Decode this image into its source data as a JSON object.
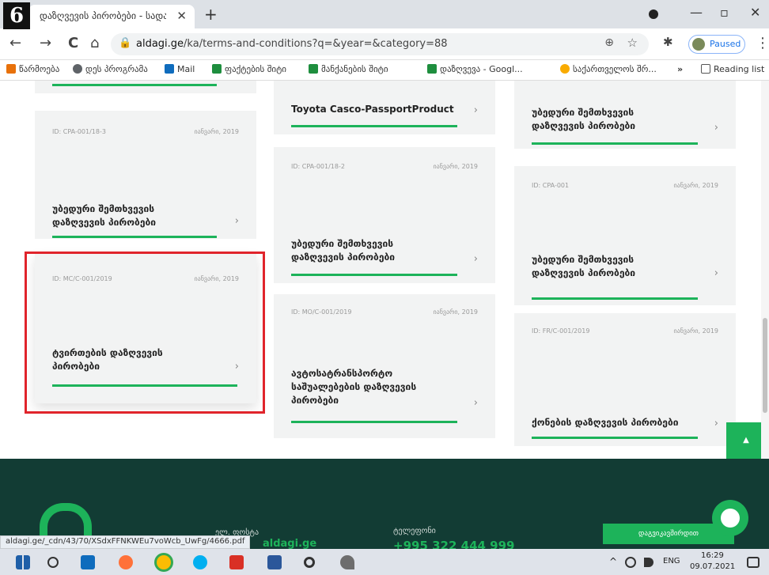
{
  "step_badge": "6",
  "tab": {
    "title": "დაზღვევის პირობები - სადაზ",
    "close": "✕",
    "new": "+"
  },
  "window": {
    "minimize": "—",
    "maximize": "▫",
    "close": "✕"
  },
  "toolbar": {
    "back": "←",
    "forward": "→",
    "reload": "C",
    "home": "⌂",
    "url_domain": "aldagi.ge",
    "url_path": "/ka/terms-and-conditions?q=&year=&category=88",
    "zoom": "⊕",
    "star": "☆",
    "extensions": "✱",
    "paused": "Paused",
    "menu": "⋮"
  },
  "bookmarks": [
    {
      "label": "წარმოება",
      "color": "#e8710a"
    },
    {
      "label": "დეს პროგრამა",
      "color": "#5f6368"
    },
    {
      "label": "Mail",
      "color": "#0f6cbd"
    },
    {
      "label": "ფაქტების შიტი",
      "color": "#1e8e3e"
    },
    {
      "label": "მანქანების შიტი",
      "color": "#1e8e3e"
    },
    {
      "label": "დაზღვევა - Googl...",
      "color": "#1e8e3e"
    },
    {
      "label": "საქართველოს შრ...",
      "color": "#f9ab00"
    }
  ],
  "bookmarks_more": "»",
  "reading_list": "Reading list",
  "cards": {
    "c1": {
      "id": "ID: CPA-001/18-3",
      "date": "იანვარი, 2019",
      "title1": "უბედური შემთხვევის",
      "title2": "დაზღვევის პირობები"
    },
    "c2": {
      "id": "ID: MC/C-001/2019",
      "date": "იანვარი, 2019",
      "title1": "ტვირთების დაზღვევის",
      "title2": "პირობები"
    },
    "c3": {
      "title1": "Toyota Casco-PassportProduct"
    },
    "c4": {
      "id": "ID: CPA-001/18-2",
      "date": "იანვარი, 2019",
      "title1": "უბედური შემთხვევის",
      "title2": "დაზღვევის პირობები"
    },
    "c5": {
      "id": "ID: MO/C-001/2019",
      "date": "იანვარი, 2019",
      "title1": "ავტოსატრანსპორტო",
      "title2": "საშუალებების დაზღვევის",
      "title3": "პირობები"
    },
    "c6": {
      "title1": "უბედური შემთხვევის",
      "title2": "დაზღვევის პირობები"
    },
    "c7": {
      "id": "ID: CPA-001",
      "date": "იანვარი, 2019",
      "title1": "უბედური შემთხვევის",
      "title2": "დაზღვევის პირობები"
    },
    "c8": {
      "id": "ID: FR/C-001/2019",
      "date": "იანვარი, 2019",
      "title1": "ქონების დაზღვევის პირობები"
    }
  },
  "arrow": "›",
  "scroll_top_icon": "▲",
  "footer": {
    "email_label": "ელ. ფოსტა",
    "email_partial": "aldagi.ge",
    "phone_label": "ტელეფონი",
    "phone": "+995 322 444 999",
    "contact_button": "დაგვიკავშირდით"
  },
  "status_url": "aldagi.ge/_cdn/43/70/XSdxFFNKWEu7voWcb_UwFg/4666.pdf",
  "taskbar": {
    "lang": "ENG",
    "time": "16:29",
    "date": "09.07.2021",
    "chevron": "^"
  }
}
